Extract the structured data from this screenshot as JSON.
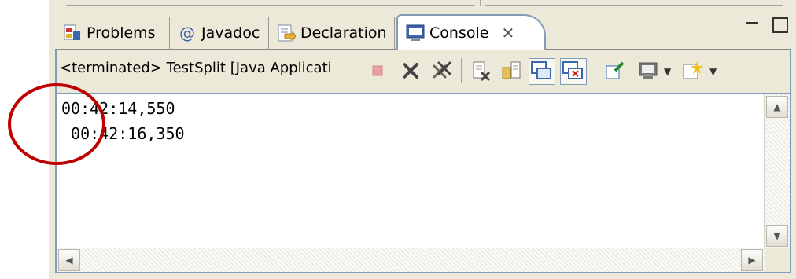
{
  "tabs": [
    {
      "label": "Problems",
      "icon": "problems-icon"
    },
    {
      "label": "Javadoc",
      "icon": "at-sign-icon"
    },
    {
      "label": "Declaration",
      "icon": "declaration-icon"
    },
    {
      "label": "Console",
      "icon": "console-icon",
      "active": true
    }
  ],
  "console": {
    "status": "<terminated> TestSplit [Java Applicati",
    "lines": [
      "00:42:14,550",
      " 00:42:16,350"
    ]
  },
  "colors": {
    "tab_border": "#7f9db9",
    "panel_bg": "#ece9d8",
    "annotation": "#c00000"
  },
  "toolbar_icons": [
    "terminate-icon",
    "remove-launch-icon",
    "remove-all-launches-icon",
    "scroll-lock-icon",
    "word-wrap-icon",
    "show-on-stdout-icon",
    "show-on-stderr-icon",
    "pin-console-icon",
    "display-console-icon",
    "open-console-icon"
  ]
}
